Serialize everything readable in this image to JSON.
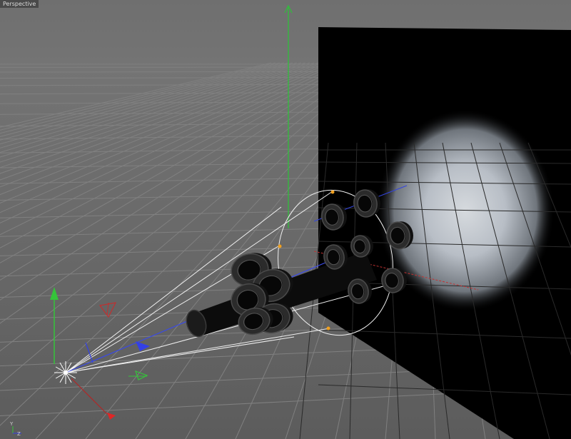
{
  "viewport": {
    "label": "Perspective",
    "axis_y_label": "Y",
    "axis_z_label": "Z"
  },
  "colors": {
    "background_top": "#707070",
    "background_bottom": "#5e5e5e",
    "grid_line": "#7f7f7f",
    "wall": "#000000",
    "glow": "#c8ccd2",
    "axis_x": "#e03030",
    "axis_y": "#29c22a",
    "axis_z": "#3340e6",
    "light_cone": "#f2f2f2",
    "handle": "#f0a020"
  },
  "icons": [
    "light-source-icon",
    "world-axis-gizmo",
    "move-axis-handles"
  ]
}
